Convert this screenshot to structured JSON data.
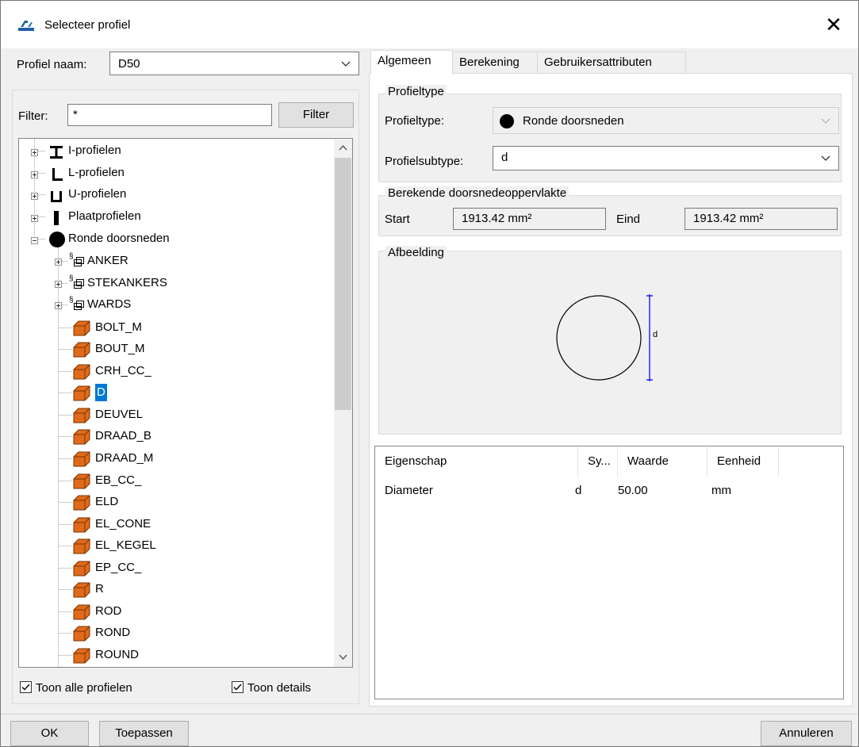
{
  "window": {
    "title": "Selecteer profiel",
    "close_glyph": "✕"
  },
  "profile_name": {
    "label": "Profiel naam:",
    "value": "D50"
  },
  "filter": {
    "label": "Filter:",
    "value": "*",
    "button": "Filter"
  },
  "tree": {
    "groups": [
      {
        "label": "I-profielen",
        "icon": "i-beam-icon"
      },
      {
        "label": "L-profielen",
        "icon": "l-angle-icon"
      },
      {
        "label": "U-profielen",
        "icon": "u-channel-icon"
      },
      {
        "label": "Plaatprofielen",
        "icon": "plate-icon"
      },
      {
        "label": "Ronde doorsneden",
        "icon": "circle-filled-icon"
      }
    ],
    "subgroups": [
      {
        "label": "ANKER",
        "prefix": "§"
      },
      {
        "label": "STEKANKERS",
        "prefix": "§"
      },
      {
        "label": "WARDS",
        "prefix": "§"
      }
    ],
    "items": [
      "BOLT_M",
      "BOUT_M",
      "CRH_CC_",
      "D",
      "DEUVEL",
      "DRAAD_B",
      "DRAAD_M",
      "EB_CC_",
      "ELD",
      "EL_CONE",
      "EL_KEGEL",
      "EP_CC_",
      "R",
      "ROD",
      "ROND",
      "ROUND"
    ],
    "selected": "D"
  },
  "checkboxes": {
    "show_all": "Toon alle profielen",
    "show_details": "Toon details"
  },
  "tabs": [
    "Algemeen",
    "Berekening",
    "Gebruikersattributen"
  ],
  "profiletype_group": {
    "title": "Profieltype",
    "type_label": "Profieltype:",
    "type_value": "Ronde doorsneden",
    "subtype_label": "Profielsubtype:",
    "subtype_value": "d"
  },
  "area_group": {
    "title": "Berekende doorsnedeoppervlakte",
    "start_label": "Start",
    "start_value": "1913.42 mm²",
    "end_label": "Eind",
    "end_value": "1913.42 mm²"
  },
  "image_group": {
    "title": "Afbeelding",
    "dimension_label": "d"
  },
  "properties": {
    "headers": [
      "Eigenschap",
      "Sy...",
      "Waarde",
      "Eenheid"
    ],
    "rows": [
      [
        "Diameter",
        "d",
        "50.00",
        "mm"
      ]
    ]
  },
  "buttons": {
    "ok": "OK",
    "apply": "Toepassen",
    "cancel": "Annuleren"
  },
  "colors": {
    "selection": "#0078d7",
    "dimension_line": "#1a1aff",
    "profile_icon": "#e06a1b"
  }
}
